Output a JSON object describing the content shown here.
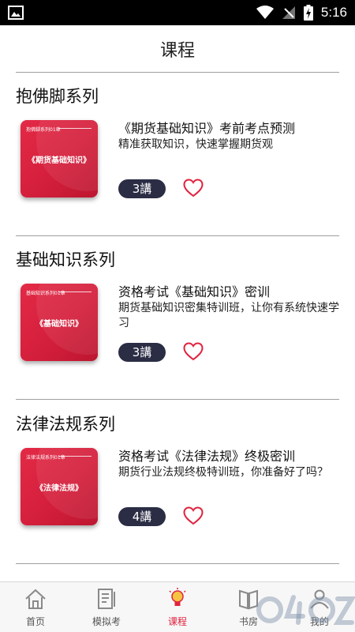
{
  "status_bar": {
    "time": "5:16"
  },
  "header": {
    "title": "课程"
  },
  "sections": [
    {
      "title": "抱佛脚系列",
      "cover": {
        "small_text": "抱佛脚系列01章",
        "title": "《期货基础知识》"
      },
      "course_title": "《期货基础知识》考前考点预测",
      "description": "精准获取知识，快速掌握期货观",
      "lessons": "3講"
    },
    {
      "title": "基础知识系列",
      "cover": {
        "small_text": "基础知识系列01章",
        "title": "《基础知识》"
      },
      "course_title": "资格考试《基础知识》密训",
      "description": "期货基础知识密集特训班，让你有系统快速学习",
      "lessons": "3講"
    },
    {
      "title": "法律法规系列",
      "cover": {
        "small_text": "法律法规系列01章",
        "title": "《法律法规》"
      },
      "course_title": "资格考试《法律法规》终极密训",
      "description": "期货行业法规终极特训班，你准备好了吗？",
      "lessons": "4講"
    }
  ],
  "bottom_nav": [
    {
      "label": "首页",
      "icon": "home-icon"
    },
    {
      "label": "模拟考",
      "icon": "exam-icon"
    },
    {
      "label": "课程",
      "icon": "lightbulb-icon",
      "active": true
    },
    {
      "label": "书房",
      "icon": "book-icon"
    },
    {
      "label": "我的",
      "icon": "profile-icon"
    }
  ],
  "colors": {
    "accent": "#e0233f",
    "badge": "#2b2d45",
    "cover": "#d41f3c"
  }
}
